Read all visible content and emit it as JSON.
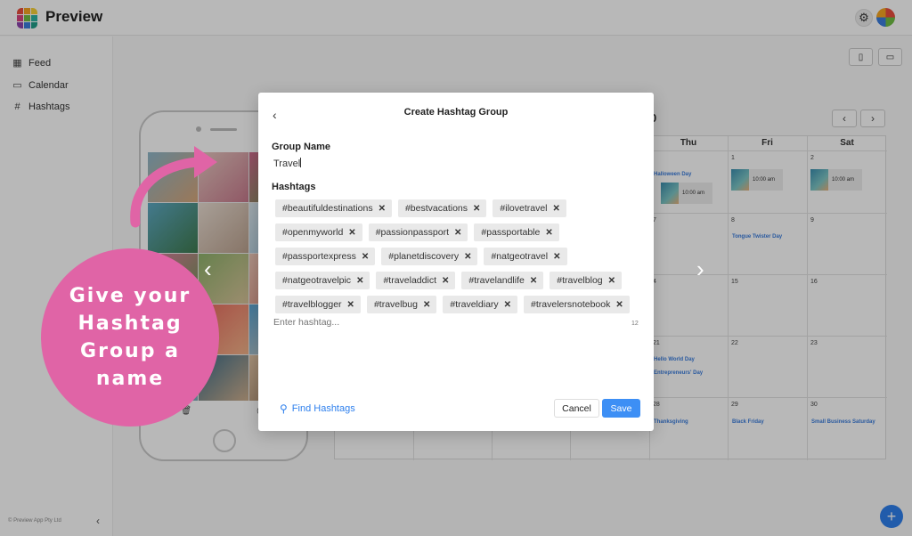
{
  "app": {
    "title": "Preview"
  },
  "sidebar": {
    "items": [
      {
        "label": "Feed",
        "icon": "grid-icon"
      },
      {
        "label": "Calendar",
        "icon": "calendar-icon"
      },
      {
        "label": "Hashtags",
        "icon": "hash-icon"
      }
    ],
    "footer": "© Preview App Pty Ltd"
  },
  "calendar": {
    "month_suffix": "0",
    "headers": [
      "Thu",
      "Fri",
      "Sat"
    ],
    "cells": [
      {
        "num": "",
        "holiday": "Halloween Day",
        "post_time": "10:00 am"
      },
      {
        "num": "1",
        "post_time": "10:00 am"
      },
      {
        "num": "2",
        "post_time": "10:00 am"
      },
      {
        "num": "7"
      },
      {
        "num": "8",
        "holiday": "Tongue Twister Day"
      },
      {
        "num": "9"
      },
      {
        "num": "4"
      },
      {
        "num": "15"
      },
      {
        "num": "16"
      },
      {
        "num": "21",
        "holiday": "Hello World Day",
        "holiday2": "Entrepreneurs' Day"
      },
      {
        "num": "22"
      },
      {
        "num": "23"
      },
      {
        "num": "28",
        "holiday": "Thanksgiving"
      },
      {
        "num": "29",
        "holiday": "Black Friday"
      },
      {
        "num": "30",
        "holiday": "Small Business Saturday"
      }
    ]
  },
  "promo": {
    "text": "Give your Hashtag Group a name"
  },
  "modal": {
    "title": "Create Hashtag Group",
    "group_name_label": "Group Name",
    "group_name_value": "Travel",
    "hashtags_label": "Hashtags",
    "tag_rows": [
      [
        "#beautifuldestinations",
        "#bestvacations",
        "#ilovetravel"
      ],
      [
        "#openmyworld",
        "#passionpassport",
        "#passportable"
      ],
      [
        "#passportexpress",
        "#planetdiscovery",
        "#natgeotravel"
      ],
      [
        "#natgeotravelpic",
        "#traveladdict",
        "#travelandlife",
        "#travelblog"
      ],
      [
        "#travelblogger",
        "#travelbug",
        "#traveldiary",
        "#travelersnotebook"
      ]
    ],
    "remove_glyph": "✕",
    "hashtag_placeholder": "Enter hashtag...",
    "count": "12",
    "find_label": "Find Hashtags",
    "cancel_label": "Cancel",
    "save_label": "Save"
  },
  "colors": {
    "accent": "#3d8ff5",
    "promo": "#e064a6",
    "holiday": "#3b7ddd"
  }
}
